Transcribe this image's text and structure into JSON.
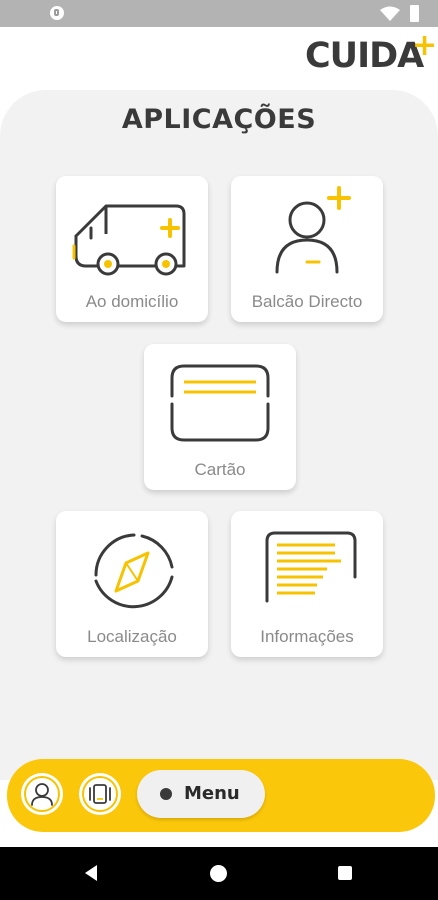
{
  "brand": {
    "name": "CUIDA",
    "plus": "+",
    "accent": "#f7c300",
    "dark": "#3a3a3a"
  },
  "page": {
    "title": "APLICAÇÕES"
  },
  "apps": [
    {
      "label": "Ao domicílio",
      "icon": "ambulance-icon"
    },
    {
      "label": "Balcão Directo",
      "icon": "person-plus-icon"
    },
    {
      "label": "Cartão",
      "icon": "card-icon"
    },
    {
      "label": "Localização",
      "icon": "compass-icon"
    },
    {
      "label": "Informações",
      "icon": "document-icon"
    }
  ],
  "bottom_bar": {
    "profile_icon": "user-icon",
    "contact_icon": "phone-contact-icon",
    "menu_label": "Menu",
    "background": "#fbc70a"
  },
  "system_nav": {
    "back_icon": "back-triangle-icon",
    "home_icon": "home-circle-icon",
    "recents_icon": "recents-square-icon"
  }
}
